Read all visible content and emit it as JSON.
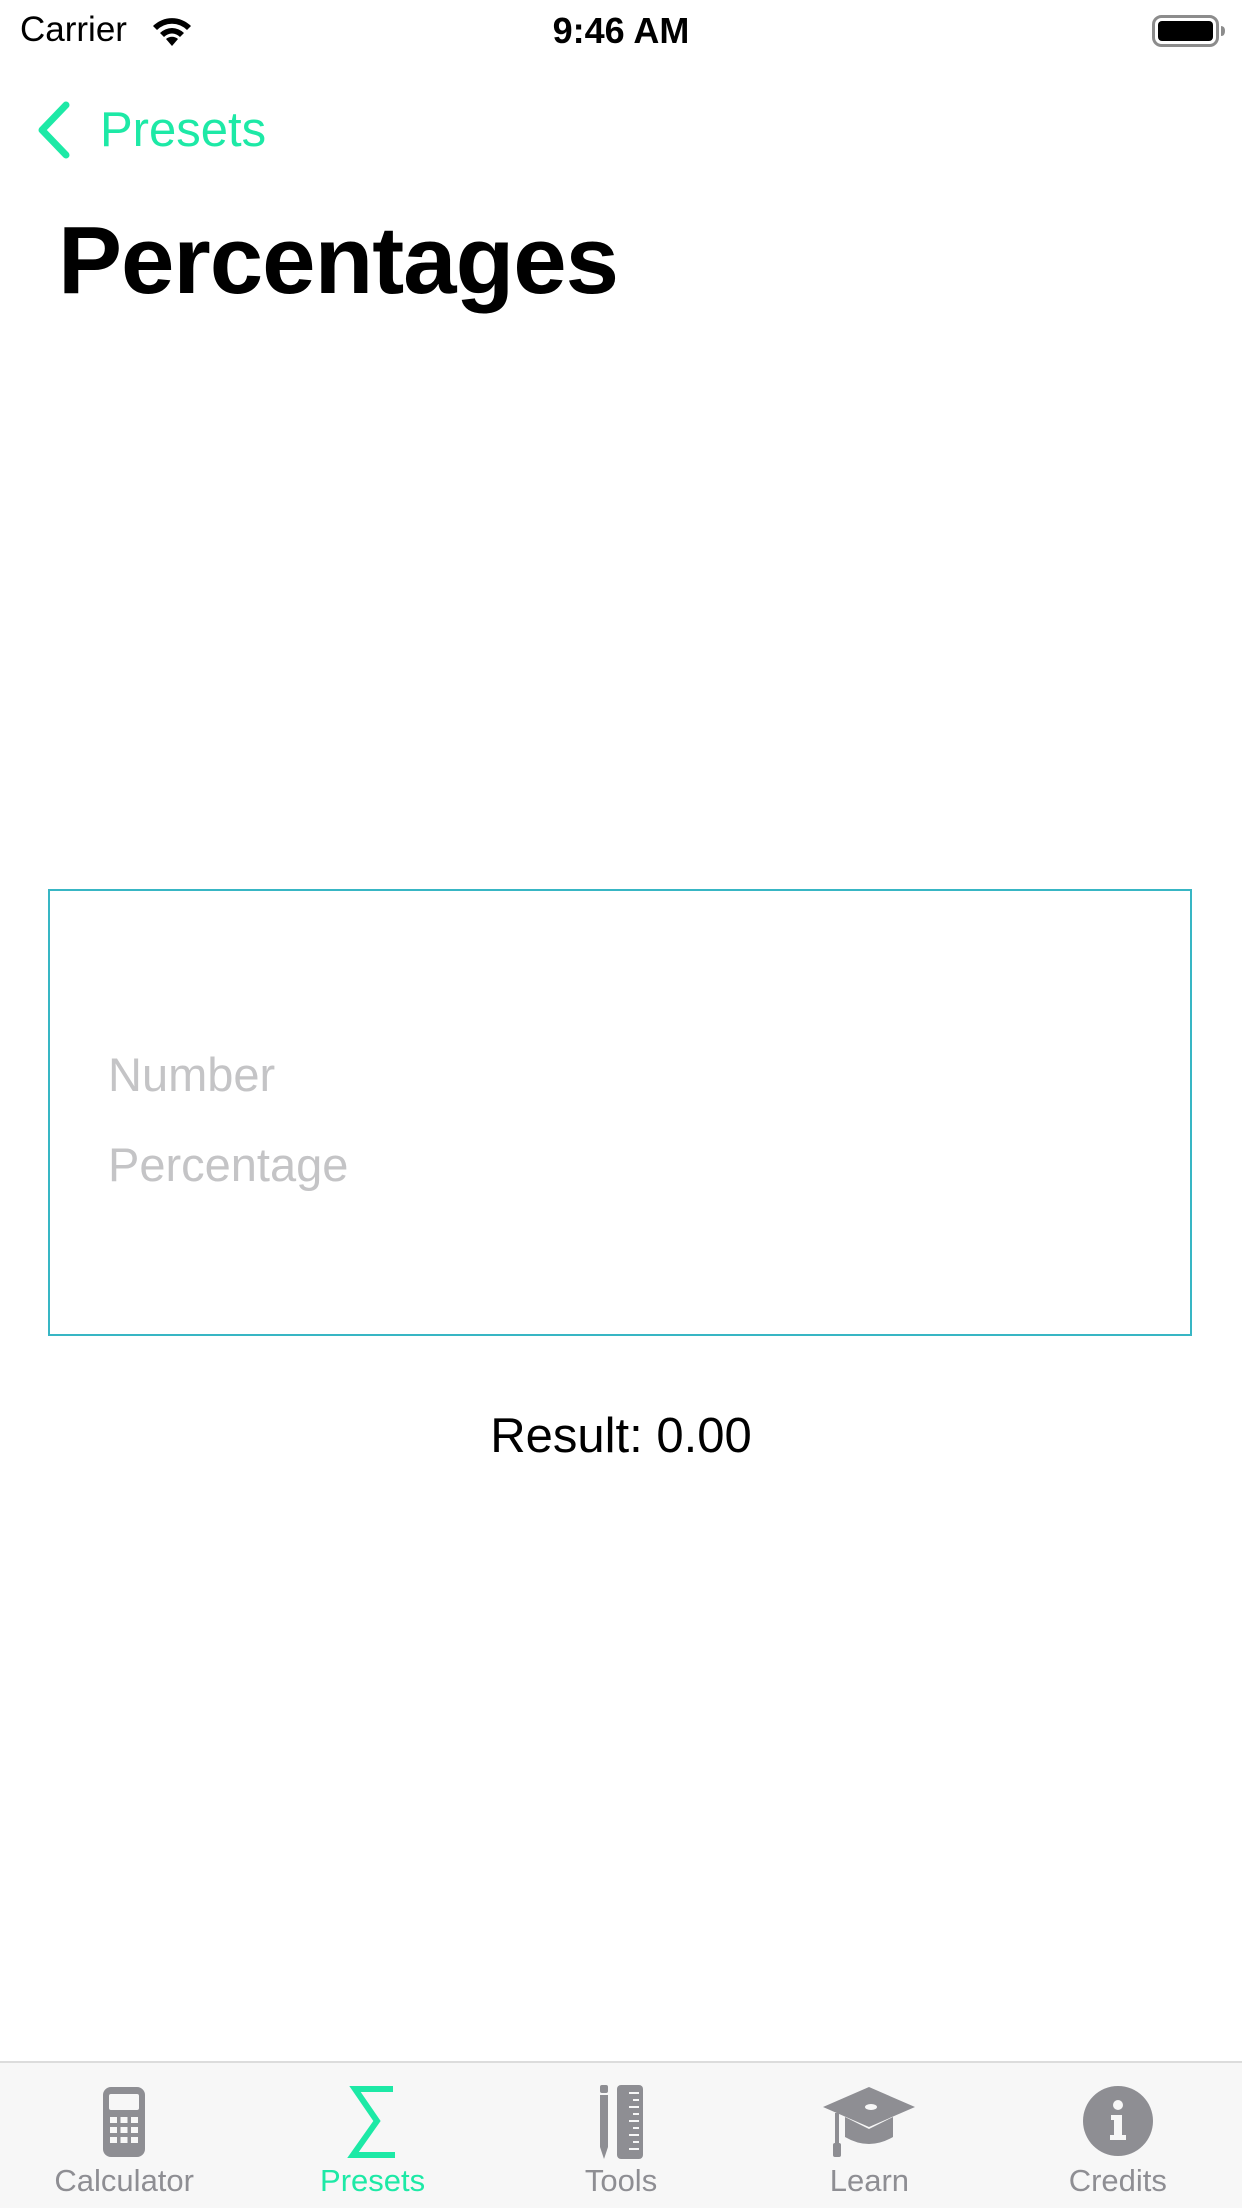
{
  "status_bar": {
    "carrier": "Carrier",
    "time": "9:46 AM"
  },
  "nav": {
    "back_label": "Presets",
    "title": "Percentages"
  },
  "form": {
    "number_placeholder": "Number",
    "number_value": "",
    "percentage_placeholder": "Percentage",
    "percentage_value": ""
  },
  "result": {
    "text": "Result: 0.00"
  },
  "tab_bar": {
    "tabs": [
      {
        "label": "Calculator",
        "icon": "calculator-icon",
        "active": false
      },
      {
        "label": "Presets",
        "icon": "sigma-icon",
        "active": true
      },
      {
        "label": "Tools",
        "icon": "tools-icon",
        "active": false
      },
      {
        "label": "Learn",
        "icon": "graduation-cap-icon",
        "active": false
      },
      {
        "label": "Credits",
        "icon": "info-icon",
        "active": false
      }
    ]
  },
  "colors": {
    "accent": "#1de9a6",
    "form_border": "#38b6c4",
    "inactive_tab": "#8e8e93",
    "placeholder": "#c4c4c6"
  }
}
